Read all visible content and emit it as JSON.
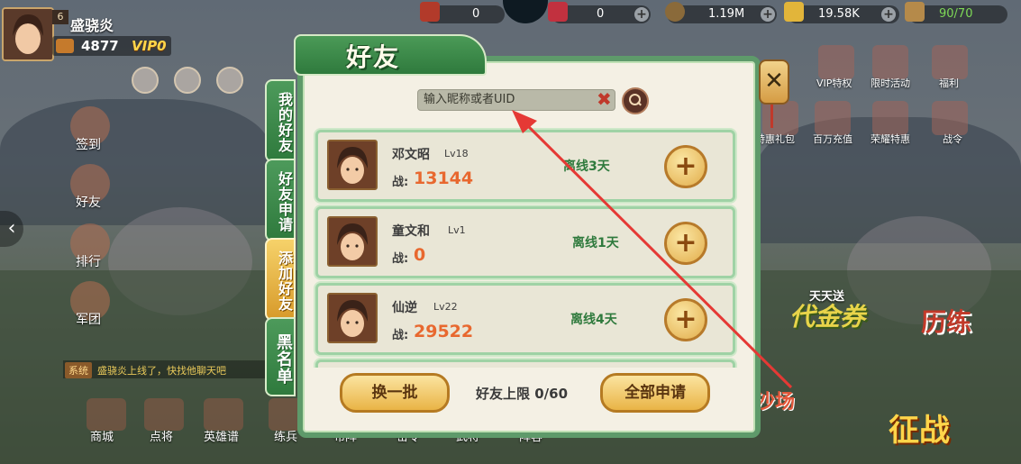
{
  "hud": {
    "player_level": "6",
    "player_name": "盛骁炎",
    "power": "4877",
    "vip_label": "VIP0",
    "resources": [
      {
        "value": "0",
        "icon": "jade-icon"
      },
      {
        "value": "0",
        "icon": "red-gem-icon"
      },
      {
        "value": "1.19M",
        "icon": "coin-icon"
      },
      {
        "value": "19.58K",
        "icon": "gold-ingot-icon"
      },
      {
        "value": "90/70",
        "icon": "stamina-icon"
      }
    ]
  },
  "left_menu": [
    "签到",
    "好友",
    "排行",
    "军团"
  ],
  "right_menu": [
    "VIP特权",
    "限时活动",
    "福利",
    "特惠礼包",
    "百万充值",
    "荣耀特惠",
    "战令"
  ],
  "bottom_menu": [
    "商城",
    "点将",
    "英雄谱",
    "练兵",
    "布阵",
    "密令",
    "武将",
    "阵容"
  ],
  "chat": {
    "tag": "系统",
    "text": "盛骁炎上线了，快找他聊天吧"
  },
  "promos": {
    "promo1_top": "天天送",
    "promo1": "代金券",
    "promo2": "历练",
    "promo3": "征战",
    "promo4": "沙场"
  },
  "modal": {
    "title": "好友",
    "close_symbol": "✕",
    "tabs": [
      {
        "label": "我的好友",
        "active": false
      },
      {
        "label": "好友申请",
        "active": false
      },
      {
        "label": "添加好友",
        "active": true
      },
      {
        "label": "黑名单",
        "active": false
      }
    ],
    "search_placeholder": "输入昵称或者UID",
    "power_label": "战:",
    "friends": [
      {
        "name": "邓文昭",
        "level": "Lv18",
        "power": "13144",
        "status": "离线3天"
      },
      {
        "name": "童文和",
        "level": "Lv1",
        "power": "0",
        "status": "离线1天"
      },
      {
        "name": "仙逆",
        "level": "Lv22",
        "power": "29522",
        "status": "离线4天"
      }
    ],
    "refresh_button": "换一批",
    "limit_text": "好友上限 0/60",
    "apply_all_button": "全部申请"
  },
  "colors": {
    "frame_green": "#5e9a6a",
    "power_orange": "#e8682f",
    "status_green": "#2f7a3d",
    "button_gold": "#e9b446",
    "annotation_red": "#e53935"
  }
}
